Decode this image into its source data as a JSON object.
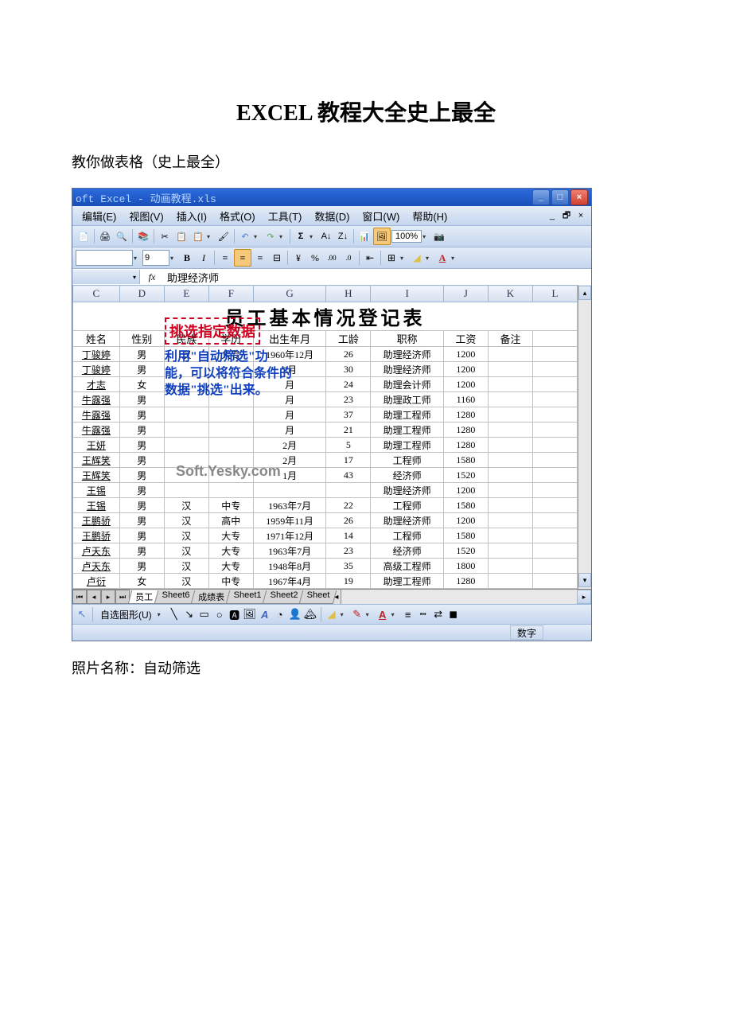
{
  "doc": {
    "title": "EXCEL 教程大全史上最全",
    "subtitle": "教你做表格（史上最全）",
    "caption": "照片名称：自动筛选"
  },
  "window": {
    "title": "oft Excel - 动画教程.xls"
  },
  "menus": [
    "编辑(E)",
    "视图(V)",
    "插入(I)",
    "格式(O)",
    "工具(T)",
    "数据(D)",
    "窗口(W)",
    "帮助(H)"
  ],
  "zoom": "100%",
  "font_size": "9",
  "formula": {
    "name_box": "",
    "fx_label": "fx",
    "value": "助理经济师"
  },
  "columns": [
    "C",
    "D",
    "E",
    "F",
    "G",
    "H",
    "I",
    "J",
    "K",
    "L"
  ],
  "sheet_title": "员工基本情况登记表",
  "headers": [
    "姓名",
    "性别",
    "民族",
    "学历",
    "出生年月",
    "工龄",
    "职称",
    "工资",
    "备注"
  ],
  "rows": [
    {
      "name": "丁骏婷",
      "sex": "男",
      "eth": "汉",
      "edu": "大专",
      "dob": "1960年12月",
      "yrs": "26",
      "title": "助理经济师",
      "sal": "1200",
      "note": ""
    },
    {
      "name": "丁骏婷",
      "sex": "男",
      "eth": "",
      "edu": "",
      "dob": "2月",
      "yrs": "30",
      "title": "助理经济师",
      "sal": "1200",
      "note": ""
    },
    {
      "name": "才志",
      "sex": "女",
      "eth": "",
      "edu": "",
      "dob": "月",
      "yrs": "24",
      "title": "助理会计师",
      "sal": "1200",
      "note": ""
    },
    {
      "name": "牛露强",
      "sex": "男",
      "eth": "",
      "edu": "",
      "dob": "月",
      "yrs": "23",
      "title": "助理政工师",
      "sal": "1160",
      "note": ""
    },
    {
      "name": "牛露强",
      "sex": "男",
      "eth": "",
      "edu": "",
      "dob": "月",
      "yrs": "37",
      "title": "助理工程师",
      "sal": "1280",
      "note": ""
    },
    {
      "name": "牛露强",
      "sex": "男",
      "eth": "",
      "edu": "",
      "dob": "月",
      "yrs": "21",
      "title": "助理工程师",
      "sal": "1280",
      "note": ""
    },
    {
      "name": "王妍",
      "sex": "男",
      "eth": "",
      "edu": "",
      "dob": "2月",
      "yrs": "5",
      "title": "助理工程师",
      "sal": "1280",
      "note": ""
    },
    {
      "name": "王辉笑",
      "sex": "男",
      "eth": "",
      "edu": "",
      "dob": "2月",
      "yrs": "17",
      "title": "工程师",
      "sal": "1580",
      "note": ""
    },
    {
      "name": "王辉笑",
      "sex": "男",
      "eth": "",
      "edu": "",
      "dob": "1月",
      "yrs": "43",
      "title": "经济师",
      "sal": "1520",
      "note": ""
    },
    {
      "name": "王锡",
      "sex": "男",
      "eth": "",
      "edu": "",
      "dob": "",
      "yrs": "",
      "title": "助理经济师",
      "sal": "1200",
      "note": ""
    },
    {
      "name": "王锡",
      "sex": "男",
      "eth": "汉",
      "edu": "中专",
      "dob": "1963年7月",
      "yrs": "22",
      "title": "工程师",
      "sal": "1580",
      "note": ""
    },
    {
      "name": "王鹏骄",
      "sex": "男",
      "eth": "汉",
      "edu": "高中",
      "dob": "1959年11月",
      "yrs": "26",
      "title": "助理经济师",
      "sal": "1200",
      "note": ""
    },
    {
      "name": "王鹏骄",
      "sex": "男",
      "eth": "汉",
      "edu": "大专",
      "dob": "1971年12月",
      "yrs": "14",
      "title": "工程师",
      "sal": "1580",
      "note": ""
    },
    {
      "name": "卢天东",
      "sex": "男",
      "eth": "汉",
      "edu": "大专",
      "dob": "1963年7月",
      "yrs": "23",
      "title": "经济师",
      "sal": "1520",
      "note": ""
    },
    {
      "name": "卢天东",
      "sex": "男",
      "eth": "汉",
      "edu": "大专",
      "dob": "1948年8月",
      "yrs": "35",
      "title": "高级工程师",
      "sal": "1800",
      "note": ""
    },
    {
      "name": "卢衍",
      "sex": "女",
      "eth": "汉",
      "edu": "中专",
      "dob": "1967年4月",
      "yrs": "19",
      "title": "助理工程师",
      "sal": "1280",
      "note": ""
    }
  ],
  "callouts": {
    "c1": "挑选指定数据",
    "c2": "利用\"自动筛选\"功能，可以将符合条件的数据\"挑选\"出来。"
  },
  "watermark": "Soft.Yesky.com",
  "tabs": [
    "员工",
    "Sheet6",
    "成绩表",
    "Sheet1",
    "Sheet2",
    "Sheet"
  ],
  "draw_label": "自选图形(U)",
  "status": "数字"
}
